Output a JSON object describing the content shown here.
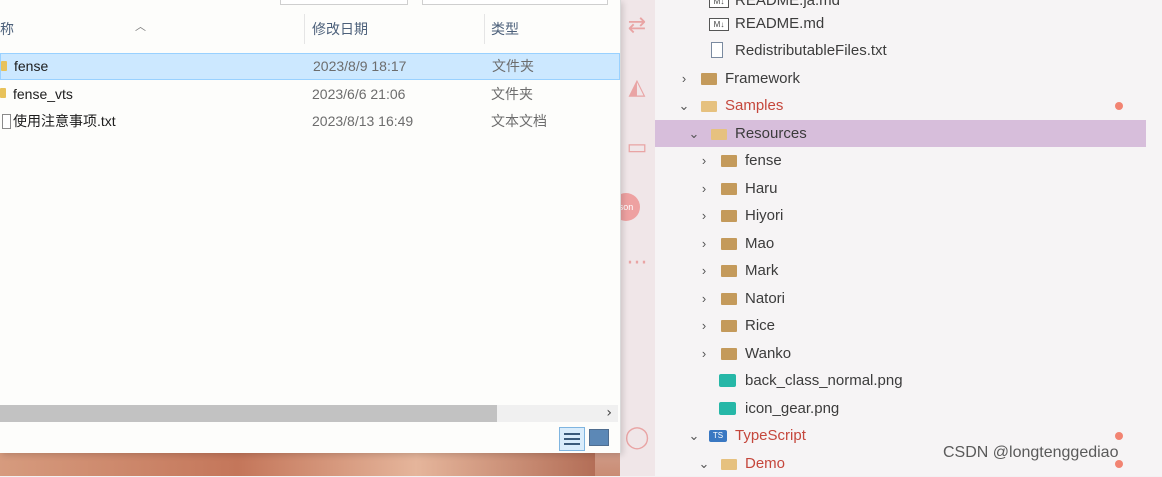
{
  "explorer": {
    "columns": {
      "name": "称",
      "date": "修改日期",
      "type": "类型"
    },
    "rows": [
      {
        "name": "fense",
        "date": "2023/8/9 18:17",
        "type": "文件夹",
        "kind": "folder",
        "selected": true
      },
      {
        "name": "fense_vts",
        "date": "2023/6/6 21:06",
        "type": "文件夹",
        "kind": "folder",
        "selected": false
      },
      {
        "name": "使用注意事项.txt",
        "date": "2023/8/13 16:49",
        "type": "文本文档",
        "kind": "txt",
        "selected": false
      }
    ],
    "scroll_right_glyph": "›"
  },
  "activity_bar": {
    "icons": [
      "source-control-icon",
      "deploy-icon",
      "terminal-icon",
      "json-icon",
      "more-icon",
      "account-icon"
    ],
    "badge": "son",
    "more": "···"
  },
  "sidebar": {
    "items": [
      {
        "label": "README.ja.md",
        "icon": "markdown-icon"
      },
      {
        "label": "README.md",
        "icon": "markdown-icon"
      },
      {
        "label": "RedistributableFiles.txt",
        "icon": "text-file-icon"
      },
      {
        "label": "Framework",
        "icon": "folder-icon"
      },
      {
        "label": "Samples",
        "icon": "folder-open-icon",
        "modified": true
      },
      {
        "label": "Resources",
        "icon": "folder-open-icon",
        "active": true
      },
      {
        "label": "fense",
        "icon": "folder-icon"
      },
      {
        "label": "Haru",
        "icon": "folder-icon"
      },
      {
        "label": "Hiyori",
        "icon": "folder-icon"
      },
      {
        "label": "Mao",
        "icon": "folder-icon"
      },
      {
        "label": "Mark",
        "icon": "folder-icon"
      },
      {
        "label": "Natori",
        "icon": "folder-icon"
      },
      {
        "label": "Rice",
        "icon": "folder-icon"
      },
      {
        "label": "Wanko",
        "icon": "folder-icon"
      },
      {
        "label": "back_class_normal.png",
        "icon": "image-icon"
      },
      {
        "label": "icon_gear.png",
        "icon": "image-icon"
      },
      {
        "label": "TypeScript",
        "icon": "typescript-folder-icon",
        "modified": true
      },
      {
        "label": "Demo",
        "icon": "folder-open-icon",
        "modified": true
      }
    ],
    "md_badge": "M↓",
    "ts_badge": "TS"
  },
  "watermark": "CSDN @longtenggediao",
  "colors": {
    "selection": "#cce8ff",
    "active_tree": "#d7bedb",
    "modified": "#c5473c",
    "badge_dot": "#f28472"
  }
}
